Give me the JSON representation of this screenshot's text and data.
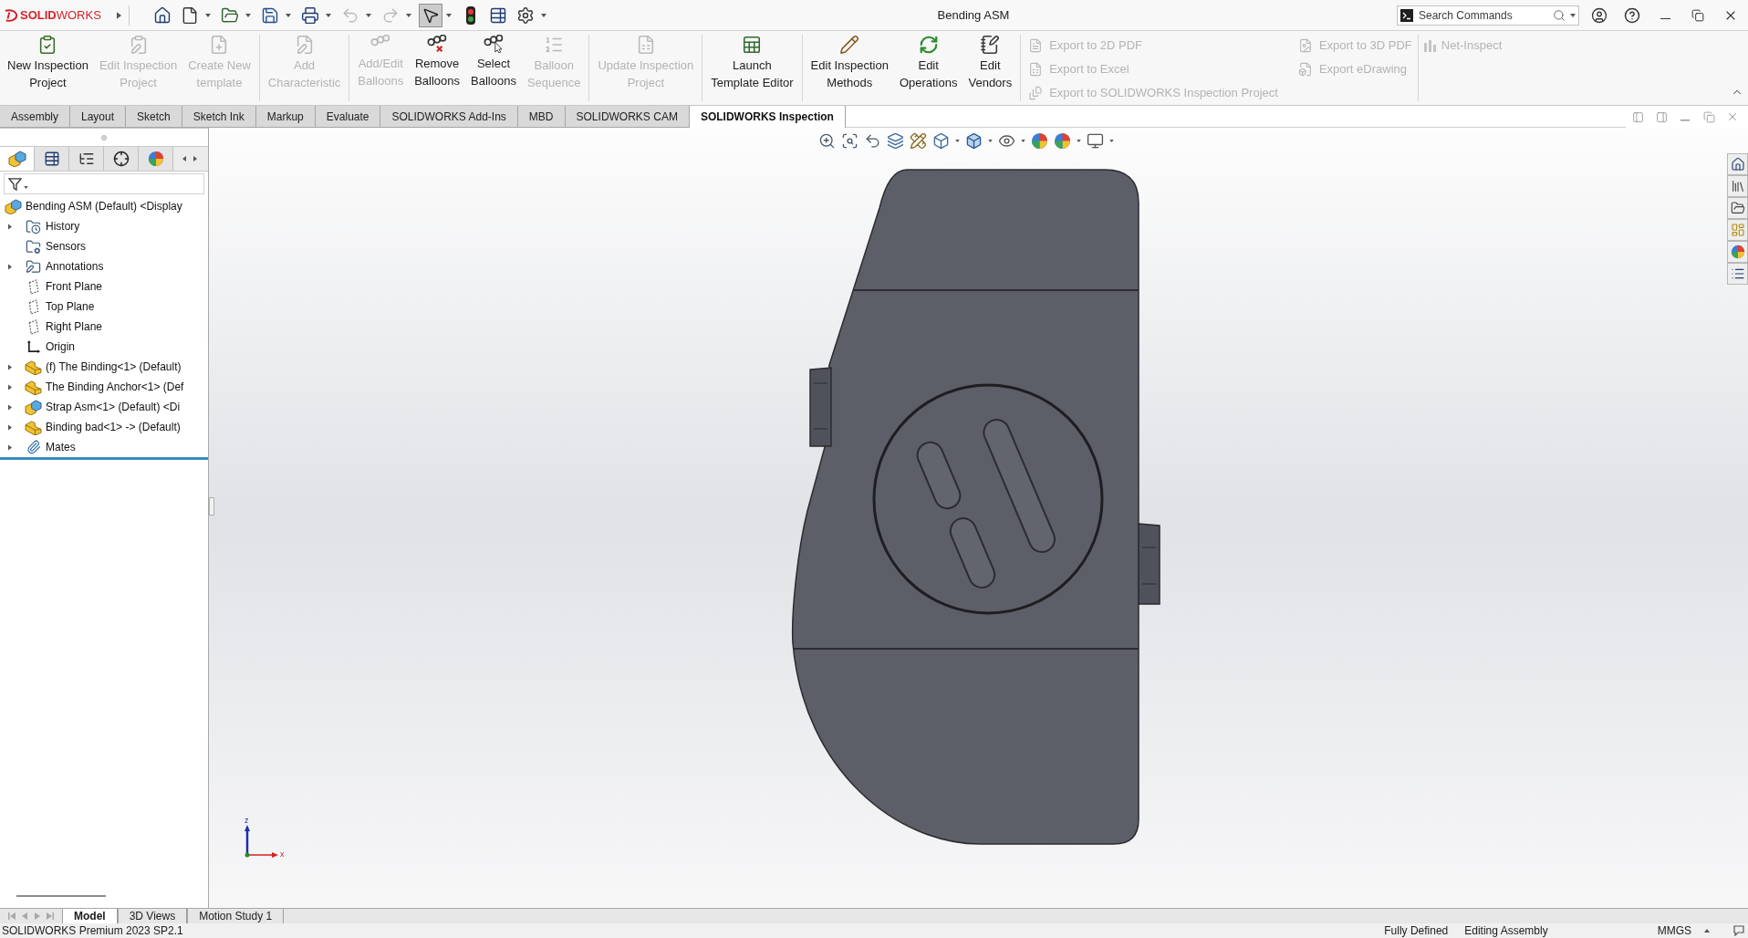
{
  "window": {
    "title": "Bending ASM"
  },
  "app_logo": {
    "text": "**SOLID**WORKS"
  },
  "quick_access": [
    {
      "kind": "home",
      "dropdown": false,
      "disabled": false,
      "selected": false
    },
    {
      "kind": "new",
      "dropdown": true,
      "disabled": false,
      "selected": false
    },
    {
      "kind": "open",
      "dropdown": true,
      "disabled": false,
      "selected": false
    },
    {
      "kind": "save",
      "dropdown": true,
      "disabled": false,
      "selected": false
    },
    {
      "kind": "print",
      "dropdown": true,
      "disabled": false,
      "selected": false
    },
    {
      "kind": "undo",
      "dropdown": true,
      "disabled": true,
      "selected": false
    },
    {
      "kind": "redo",
      "dropdown": true,
      "disabled": true,
      "selected": false
    },
    {
      "kind": "select",
      "dropdown": true,
      "disabled": false,
      "selected": true
    },
    {
      "kind": "rebuild",
      "dropdown": false,
      "disabled": false,
      "selected": false
    },
    {
      "kind": "file_properties",
      "dropdown": false,
      "disabled": false,
      "selected": false
    },
    {
      "kind": "options",
      "dropdown": true,
      "disabled": false,
      "selected": false
    }
  ],
  "search": {
    "placeholder": "Search Commands"
  },
  "ribbon": {
    "groups": [
      {
        "buttons": [
          {
            "label": "New Inspection\nProject",
            "disabled": false
          },
          {
            "label": "Edit Inspection\nProject",
            "disabled": true
          },
          {
            "label": "Create New\ntemplate",
            "disabled": true
          }
        ]
      },
      {
        "buttons": [
          {
            "label": "Add\nCharacteristic",
            "disabled": true
          }
        ]
      },
      {
        "buttons": [
          {
            "label": "Add/Edit\nBalloons",
            "disabled": true
          },
          {
            "label": "Remove\nBalloons",
            "disabled": false
          },
          {
            "label": "Select\nBalloons",
            "disabled": false
          },
          {
            "label": "Balloon\nSequence",
            "disabled": true
          }
        ]
      },
      {
        "buttons": [
          {
            "label": "Update Inspection\nProject",
            "disabled": true
          }
        ]
      },
      {
        "buttons": [
          {
            "label": "Launch\nTemplate Editor",
            "disabled": false
          }
        ]
      },
      {
        "buttons": [
          {
            "label": "Edit Inspection\nMethods",
            "disabled": false
          },
          {
            "label": "Edit\nOperations",
            "disabled": false
          },
          {
            "label": "Edit\nVendors",
            "disabled": false
          }
        ]
      }
    ],
    "export_columns": [
      [
        {
          "label": "Export to 2D PDF",
          "disabled": true
        },
        {
          "label": "Export to Excel",
          "disabled": true
        },
        {
          "label": "Export to SOLIDWORKS Inspection Project",
          "disabled": true
        }
      ],
      [
        {
          "label": "Export to 3D PDF",
          "disabled": true
        },
        {
          "label": "Export eDrawing",
          "disabled": true
        }
      ]
    ],
    "extra": [
      {
        "label": "Net-Inspect",
        "disabled": true
      }
    ]
  },
  "tabs": [
    {
      "label": "Assembly",
      "selected": false
    },
    {
      "label": "Layout",
      "selected": false
    },
    {
      "label": "Sketch",
      "selected": false
    },
    {
      "label": "Sketch Ink",
      "selected": false
    },
    {
      "label": "Markup",
      "selected": false
    },
    {
      "label": "Evaluate",
      "selected": false
    },
    {
      "label": "SOLIDWORKS Add-Ins",
      "selected": false
    },
    {
      "label": "MBD",
      "selected": false
    },
    {
      "label": "SOLIDWORKS CAM",
      "selected": false
    },
    {
      "label": "SOLIDWORKS Inspection",
      "selected": true
    }
  ],
  "feature_manager": {
    "tabs": [
      {
        "kind": "feature_manager",
        "selected": true
      },
      {
        "kind": "property_manager",
        "selected": false
      },
      {
        "kind": "configuration_manager",
        "selected": false
      },
      {
        "kind": "dimxpert_manager",
        "selected": false
      },
      {
        "kind": "display_manager",
        "selected": false
      }
    ],
    "tree": {
      "root": {
        "label": "Bending ASM (Default) <Display",
        "kind": "assembly",
        "children": [
          {
            "label": "History",
            "kind": "history",
            "expandable": true
          },
          {
            "label": "Sensors",
            "kind": "sensors",
            "expandable": false
          },
          {
            "label": "Annotations",
            "kind": "annotations",
            "expandable": true
          },
          {
            "label": "Front Plane",
            "kind": "plane",
            "expandable": false
          },
          {
            "label": "Top Plane",
            "kind": "plane",
            "expandable": false
          },
          {
            "label": "Right Plane",
            "kind": "plane",
            "expandable": false
          },
          {
            "label": "Origin",
            "kind": "origin",
            "expandable": false
          },
          {
            "label": "(f) The Binding<1> (Default)",
            "kind": "part",
            "expandable": true
          },
          {
            "label": "The Binding Anchor<1> (Def",
            "kind": "part",
            "expandable": true
          },
          {
            "label": "Strap Asm<1> (Default) <Di",
            "kind": "assembly",
            "expandable": true
          },
          {
            "label": "Binding bad<1> -> (Default)",
            "kind": "part",
            "expandable": true
          },
          {
            "label": "Mates",
            "kind": "mates",
            "expandable": true
          }
        ]
      }
    }
  },
  "viewport": {
    "triad": {
      "z_label": "z",
      "x_label": "x"
    }
  },
  "bottom_tabs": [
    {
      "label": "Model",
      "selected": true
    },
    {
      "label": "3D Views",
      "selected": false
    },
    {
      "label": "Motion Study 1",
      "selected": false
    }
  ],
  "status_bar": {
    "product": "SOLIDWORKS Premium 2023 SP2.1",
    "state": "Fully Defined",
    "mode": "Editing Assembly",
    "units": "MMGS"
  }
}
